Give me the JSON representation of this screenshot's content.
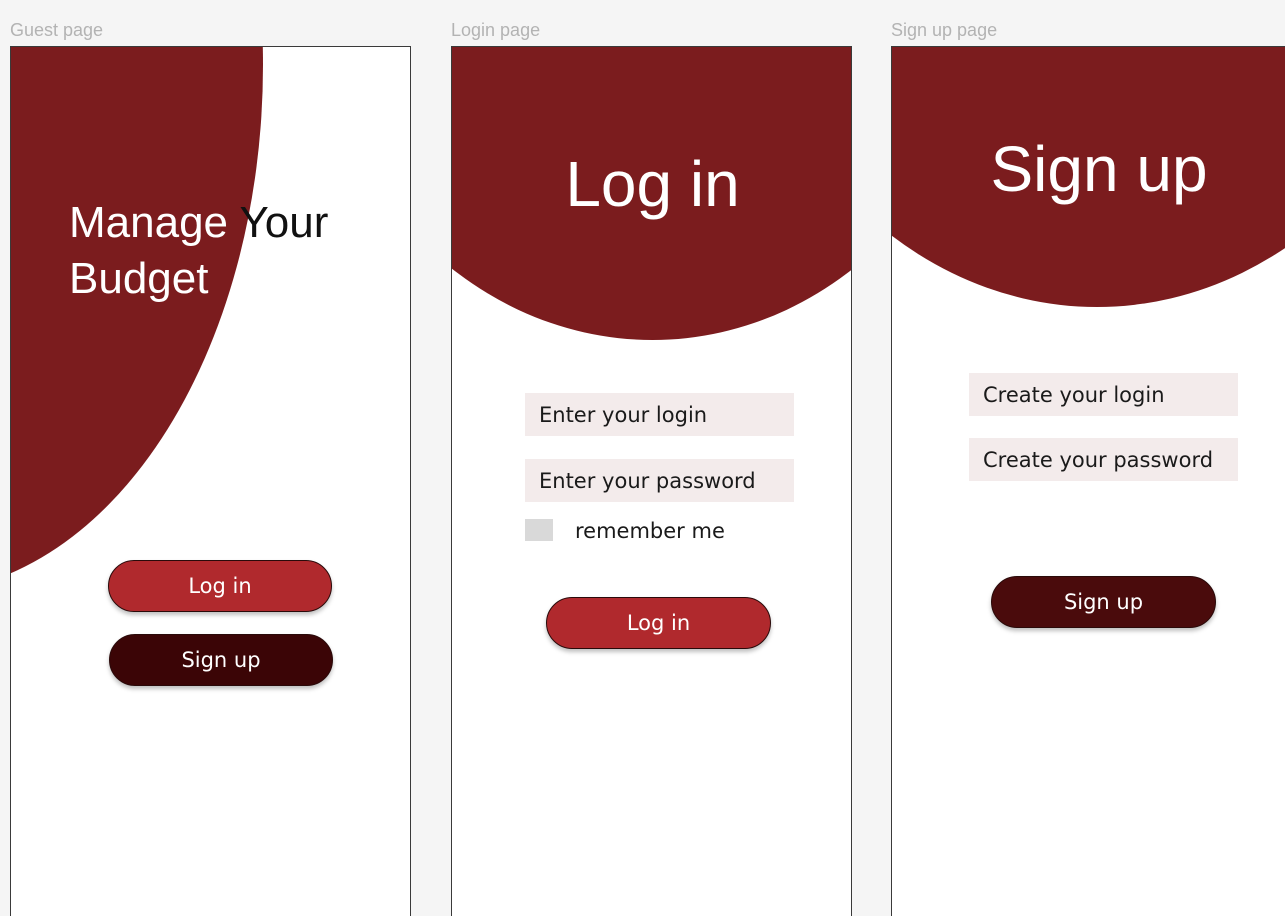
{
  "colors": {
    "canvas": "#f5f5f5",
    "brand_maroon": "#7b1c1e",
    "button_red": "#b0292d",
    "button_dark": "#3b0506",
    "field_bg": "#f3ebeb"
  },
  "guest": {
    "frame_label": "Guest page",
    "headline_line1": "Manage Your",
    "headline_line2": "Budget",
    "login_button": "Log in",
    "signup_button": "Sign up"
  },
  "login": {
    "frame_label": "Login page",
    "title": "Log in",
    "login_placeholder": "Enter your login",
    "password_placeholder": "Enter your password",
    "remember_label": "remember me",
    "remember_checked": false,
    "submit_button": "Log in"
  },
  "signup": {
    "frame_label": "Sign up page",
    "title": "Sign up",
    "login_placeholder": "Create your login",
    "password_placeholder": "Create your password",
    "submit_button": "Sign up"
  }
}
